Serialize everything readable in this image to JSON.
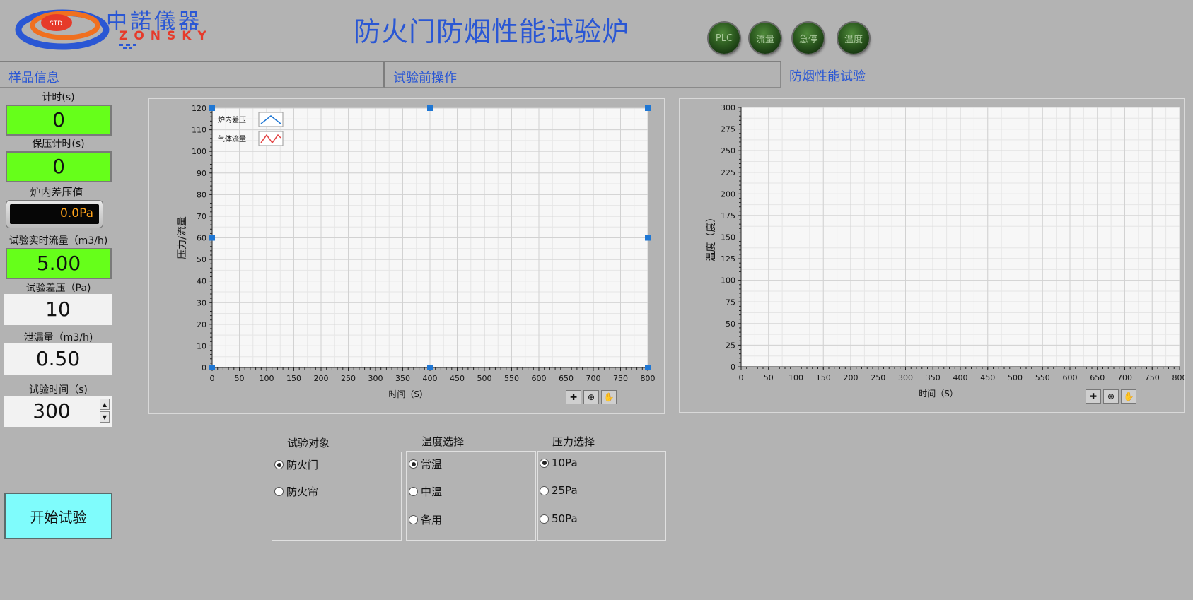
{
  "header": {
    "logo_cn": "中諾儀器",
    "logo_en": "ZONSKY",
    "logo_mark": "STD",
    "title": "防火门防烟性能试验炉",
    "indicators": [
      {
        "label": "PLC",
        "color": "#2c5a1f"
      },
      {
        "label": "流量",
        "color": "#2c5a1f"
      },
      {
        "label": "急停",
        "color": "#2c5a1f"
      },
      {
        "label": "温度",
        "color": "#2c5a1f"
      }
    ]
  },
  "tabs": [
    {
      "label": "样品信息",
      "selected": false
    },
    {
      "label": "试验前操作",
      "selected": false
    },
    {
      "label": "防烟性能试验",
      "selected": true
    }
  ],
  "left_panel": {
    "timer": {
      "label": "计时(s)",
      "value": "0"
    },
    "hold_timer": {
      "label": "保压计时(s)",
      "value": "0"
    },
    "furnace_pressure": {
      "label": "炉内差压值",
      "value": "0.0Pa"
    },
    "realtime_flow": {
      "label": "试验实时流量（m3/h)",
      "value": "5.00"
    },
    "test_pressure": {
      "label": "试验差压（Pa)",
      "value": "10"
    },
    "leakage": {
      "label": "泄漏量（m3/h)",
      "value": "0.50"
    },
    "test_time": {
      "label": "试验时间（s)",
      "value": "300"
    },
    "start_button": "开始试验"
  },
  "chart_data": [
    {
      "type": "line",
      "xlabel": "时间（S）",
      "ylabel": "压力/流量",
      "xlim": [
        0,
        800
      ],
      "ylim": [
        0,
        120
      ],
      "xticks": [
        0,
        50,
        100,
        150,
        200,
        250,
        300,
        350,
        400,
        450,
        500,
        550,
        600,
        650,
        700,
        750,
        800
      ],
      "yticks": [
        0,
        10,
        20,
        30,
        40,
        50,
        60,
        70,
        80,
        90,
        100,
        110,
        120
      ],
      "grid": true,
      "legend_position": "top-left",
      "series": [
        {
          "name": "炉内差压",
          "color": "#1f77d4",
          "x": [],
          "y": []
        },
        {
          "name": "气体流量",
          "color": "#e34040",
          "x": [],
          "y": []
        }
      ]
    },
    {
      "type": "line",
      "xlabel": "时间（S）",
      "ylabel": "温度（度）",
      "xlim": [
        0,
        800
      ],
      "ylim": [
        0,
        300
      ],
      "xticks": [
        0,
        50,
        100,
        150,
        200,
        250,
        300,
        350,
        400,
        450,
        500,
        550,
        600,
        650,
        700,
        750,
        800
      ],
      "yticks": [
        0,
        25,
        50,
        75,
        100,
        125,
        150,
        175,
        200,
        225,
        250,
        275,
        300
      ],
      "grid": true,
      "series": []
    }
  ],
  "groups": {
    "object": {
      "title": "试验对象",
      "options": [
        {
          "label": "防火门",
          "selected": true
        },
        {
          "label": "防火帘",
          "selected": false
        }
      ]
    },
    "temperature": {
      "title": "温度选择",
      "options": [
        {
          "label": "常温",
          "selected": true
        },
        {
          "label": "中温",
          "selected": false
        },
        {
          "label": "备用",
          "selected": false
        }
      ]
    },
    "pressure": {
      "title": "压力选择",
      "options": [
        {
          "label": "10Pa",
          "selected": true
        },
        {
          "label": "25Pa",
          "selected": false
        },
        {
          "label": "50Pa",
          "selected": false
        }
      ]
    }
  }
}
